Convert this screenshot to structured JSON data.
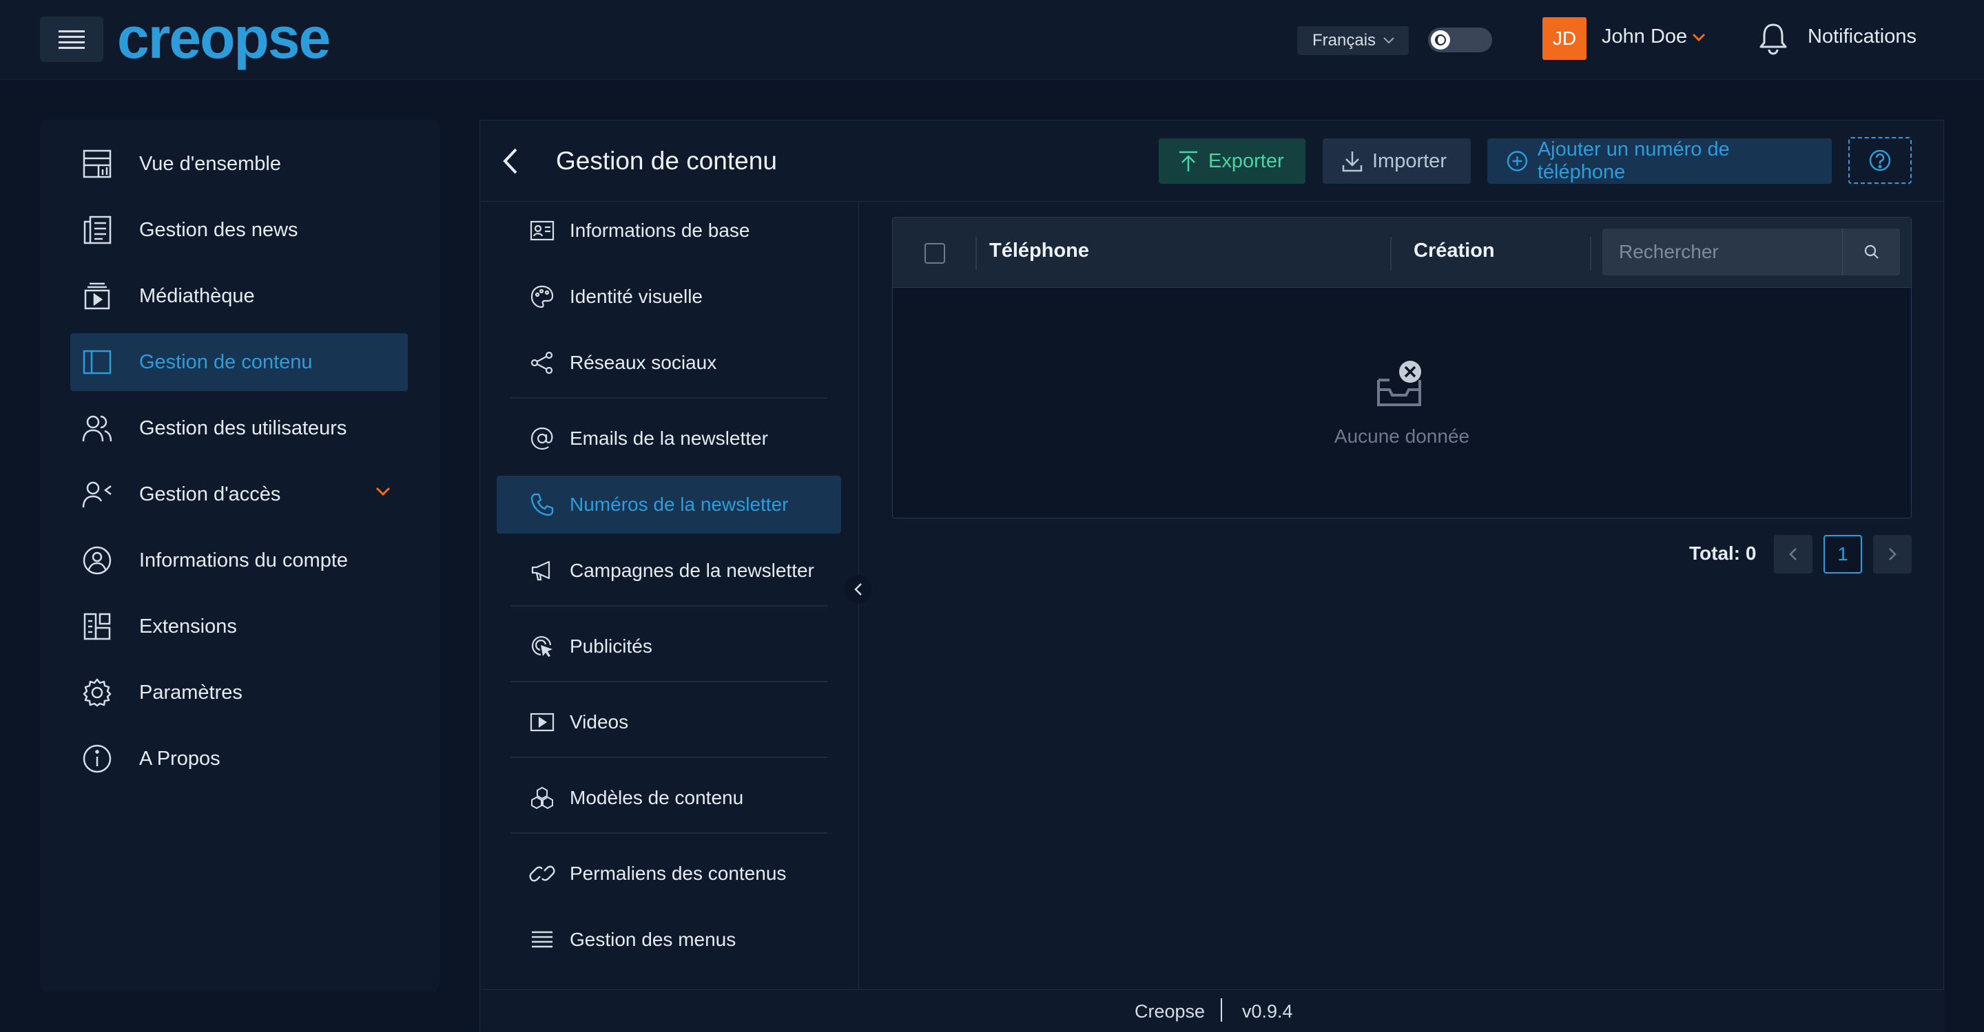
{
  "header": {
    "logo": "creopse",
    "language": "Français",
    "avatar_initials": "JD",
    "user_name": "John Doe",
    "notifications_label": "Notifications"
  },
  "sidebar": {
    "items": [
      {
        "label": "Vue d'ensemble",
        "icon": "dashboard-icon"
      },
      {
        "label": "Gestion des news",
        "icon": "news-icon"
      },
      {
        "label": "Médiathèque",
        "icon": "media-icon"
      },
      {
        "label": "Gestion de contenu",
        "icon": "layout-icon",
        "active": true
      },
      {
        "label": "Gestion des utilisateurs",
        "icon": "users-icon"
      },
      {
        "label": "Gestion d'accès",
        "icon": "user-access-icon",
        "expandable": true
      },
      {
        "label": "Informations du compte",
        "icon": "account-icon"
      },
      {
        "label": "Extensions",
        "icon": "extensions-icon"
      },
      {
        "label": "Paramètres",
        "icon": "gear-icon"
      },
      {
        "label": "A Propos",
        "icon": "info-icon"
      }
    ]
  },
  "panel": {
    "title": "Gestion de contenu",
    "export_label": "Exporter",
    "import_label": "Importer",
    "add_label": "Ajouter un numéro de téléphone"
  },
  "subnav": {
    "items": [
      {
        "label": "Informations de base",
        "icon": "id-card-icon"
      },
      {
        "label": "Identité visuelle",
        "icon": "palette-icon"
      },
      {
        "label": "Réseaux sociaux",
        "icon": "share-icon"
      },
      {
        "label": "Emails de la newsletter",
        "icon": "at-icon"
      },
      {
        "label": "Numéros de la newsletter",
        "icon": "phone-icon",
        "active": true
      },
      {
        "label": "Campagnes de la newsletter",
        "icon": "megaphone-icon"
      },
      {
        "label": "Publicités",
        "icon": "target-icon"
      },
      {
        "label": "Videos",
        "icon": "video-icon"
      },
      {
        "label": "Modèles de contenu",
        "icon": "cubes-icon"
      },
      {
        "label": "Permaliens des contenus",
        "icon": "link-icon"
      },
      {
        "label": "Gestion des menus",
        "icon": "menu-lines-icon"
      }
    ]
  },
  "table": {
    "columns": [
      "Téléphone",
      "Création"
    ],
    "search_placeholder": "Rechercher",
    "empty_text": "Aucune donnée",
    "total_label": "Total: 0",
    "current_page": "1"
  },
  "footer": {
    "brand": "Creopse",
    "version": "v0.9.4"
  },
  "colors": {
    "accent": "#2d9cdb",
    "background": "#0b1526",
    "panel": "#0e1a2b",
    "export": "#4fd1a5",
    "avatar": "#f26b1d"
  }
}
